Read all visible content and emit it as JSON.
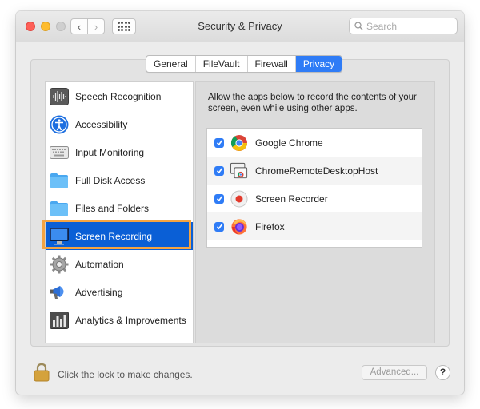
{
  "window": {
    "title": "Security & Privacy",
    "search_placeholder": "Search",
    "nav": {
      "back_glyph": "‹",
      "forward_glyph": "›"
    }
  },
  "tabs": [
    {
      "label": "General",
      "active": false
    },
    {
      "label": "FileVault",
      "active": false
    },
    {
      "label": "Firewall",
      "active": false
    },
    {
      "label": "Privacy",
      "active": true
    }
  ],
  "sidebar": {
    "items": [
      {
        "label": "Speech Recognition",
        "icon": "waveform-icon"
      },
      {
        "label": "Accessibility",
        "icon": "accessibility-icon"
      },
      {
        "label": "Input Monitoring",
        "icon": "keyboard-icon"
      },
      {
        "label": "Full Disk Access",
        "icon": "folder-icon"
      },
      {
        "label": "Files and Folders",
        "icon": "folder-icon"
      },
      {
        "label": "Screen Recording",
        "icon": "monitor-icon",
        "selected": true
      },
      {
        "label": "Automation",
        "icon": "gear-icon"
      },
      {
        "label": "Advertising",
        "icon": "megaphone-icon"
      },
      {
        "label": "Analytics & Improvements",
        "icon": "bar-chart-icon"
      }
    ]
  },
  "main": {
    "description": "Allow the apps below to record the contents of your screen, even while using other apps.",
    "apps": [
      {
        "name": "Google Chrome",
        "checked": true,
        "icon": "chrome-icon"
      },
      {
        "name": "ChromeRemoteDesktopHost",
        "checked": true,
        "icon": "remote-desktop-icon"
      },
      {
        "name": "Screen Recorder",
        "checked": true,
        "icon": "record-icon"
      },
      {
        "name": "Firefox",
        "checked": true,
        "icon": "firefox-icon"
      }
    ]
  },
  "footer": {
    "lock_text": "Click the lock to make changes.",
    "advanced_label": "Advanced...",
    "help_label": "?"
  },
  "colors": {
    "accent": "#2f7cf6",
    "selection": "#0a5fd6",
    "highlight_outline": "#f5a442"
  }
}
